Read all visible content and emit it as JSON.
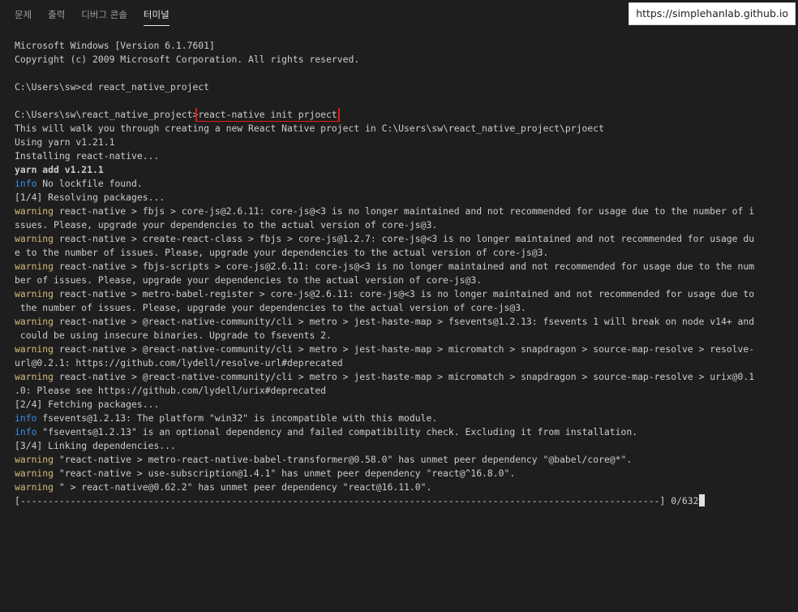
{
  "tabs": [
    {
      "label": "문제",
      "active": false
    },
    {
      "label": "출력",
      "active": false
    },
    {
      "label": "디버그 콘솔",
      "active": false
    },
    {
      "label": "터미널",
      "active": true
    }
  ],
  "watermark": "https://simplehanlab.github.io",
  "terminal": {
    "l1": "Microsoft Windows [Version 6.1.7601]",
    "l2": "Copyright (c) 2009 Microsoft Corporation. All rights reserved.",
    "l4": "C:\\Users\\sw>cd react_native_project",
    "l6_prompt": "C:\\Users\\sw\\react_native_project>",
    "l6_cmd": "react-native init prjoect",
    "l7": "This will walk you through creating a new React Native project in C:\\Users\\sw\\react_native_project\\prjoect",
    "l8": "Using yarn v1.21.1",
    "l9": "Installing react-native...",
    "l10": "yarn add v1.21.1",
    "l11_kw": "info",
    "l11": " No lockfile found.",
    "l12": "[1/4] Resolving packages...",
    "kw_warning": "warning",
    "l13": " react-native > fbjs > core-js@2.6.11: core-js@<3 is no longer maintained and not recommended for usage due to the number of i",
    "l14": "ssues. Please, upgrade your dependencies to the actual version of core-js@3.",
    "l15": " react-native > create-react-class > fbjs > core-js@1.2.7: core-js@<3 is no longer maintained and not recommended for usage du",
    "l16": "e to the number of issues. Please, upgrade your dependencies to the actual version of core-js@3.",
    "l17": " react-native > fbjs-scripts > core-js@2.6.11: core-js@<3 is no longer maintained and not recommended for usage due to the num",
    "l18": "ber of issues. Please, upgrade your dependencies to the actual version of core-js@3.",
    "l19": " react-native > metro-babel-register > core-js@2.6.11: core-js@<3 is no longer maintained and not recommended for usage due to",
    "l20": " the number of issues. Please, upgrade your dependencies to the actual version of core-js@3.",
    "l21": " react-native > @react-native-community/cli > metro > jest-haste-map > fsevents@1.2.13: fsevents 1 will break on node v14+ and",
    "l22": " could be using insecure binaries. Upgrade to fsevents 2.",
    "l23": " react-native > @react-native-community/cli > metro > jest-haste-map > micromatch > snapdragon > source-map-resolve > resolve-",
    "l24": "url@0.2.1: https://github.com/lydell/resolve-url#deprecated",
    "l25": " react-native > @react-native-community/cli > metro > jest-haste-map > micromatch > snapdragon > source-map-resolve > urix@0.1",
    "l26": ".0: Please see https://github.com/lydell/urix#deprecated",
    "l27": "[2/4] Fetching packages...",
    "l28_kw": "info",
    "l28": " fsevents@1.2.13: The platform \"win32\" is incompatible with this module.",
    "l29_kw": "info",
    "l29": " \"fsevents@1.2.13\" is an optional dependency and failed compatibility check. Excluding it from installation.",
    "l30": "[3/4] Linking dependencies...",
    "l31": " \"react-native > metro-react-native-babel-transformer@0.58.0\" has unmet peer dependency \"@babel/core@*\".",
    "l32": " \"react-native > use-subscription@1.4.1\" has unmet peer dependency \"react@^16.8.0\".",
    "l33": " \" > react-native@0.62.2\" has unmet peer dependency \"react@16.11.0\".",
    "l34": "[-------------------------------------------------------------------------------------------------------------------] 0/632"
  }
}
